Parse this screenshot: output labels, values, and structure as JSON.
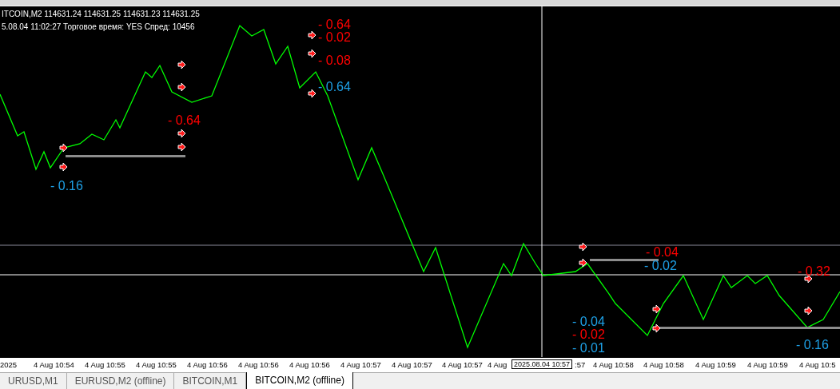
{
  "chart": {
    "symbol_line": "ITCOIN,M2  114631.24 114631.25 114631.23 114631.25",
    "info_line": "5.08.04 11:02:27  Торговое время: YES  Спред: 10456",
    "labels": [
      {
        "text": "- 0.64",
        "color": "#ff0000"
      },
      {
        "text": "- 0.02",
        "color": "#ff0000"
      },
      {
        "text": "- 0.08",
        "color": "#ff0000"
      },
      {
        "text": "- 0.64",
        "color": "#1ea0e6"
      },
      {
        "text": "- 0.64",
        "color": "#ff0000"
      },
      {
        "text": "- 0.16",
        "color": "#1ea0e6"
      },
      {
        "text": "- 0.04",
        "color": "#ff0000"
      },
      {
        "text": "- 0.02",
        "color": "#1ea0e6"
      },
      {
        "text": "- 0.04",
        "color": "#1ea0e6"
      },
      {
        "text": "- 0.02",
        "color": "#ff0000"
      },
      {
        "text": "- 0.01",
        "color": "#1ea0e6"
      },
      {
        "text": "- 0.32",
        "color": "#ff0000"
      },
      {
        "text": "- 0.16",
        "color": "#1ea0e6"
      }
    ],
    "crosshair_label": "2025.08.04 10:57"
  },
  "time_axis": [
    "2025",
    "4 Aug 10:54",
    "4 Aug 10:55",
    "4 Aug 10:55",
    "4 Aug 10:56",
    "4 Aug 10:56",
    "4 Aug 10:56",
    "4 Aug 10:57",
    "4 Aug 10:57",
    "4 Aug 10:57",
    "4 Aug",
    ":57",
    "4 Aug 10:58",
    "4 Aug 10:58",
    "4 Aug 10:59",
    "4 Aug 10:59",
    "4 Aug 10:5"
  ],
  "tabs": [
    {
      "label": "URUSD,M1",
      "selected": false
    },
    {
      "label": "EURUSD,M2 (offline)",
      "selected": false
    },
    {
      "label": "BITCOIN,M1",
      "selected": false
    },
    {
      "label": "BITCOIN,M2 (offline)",
      "selected": true
    }
  ]
}
